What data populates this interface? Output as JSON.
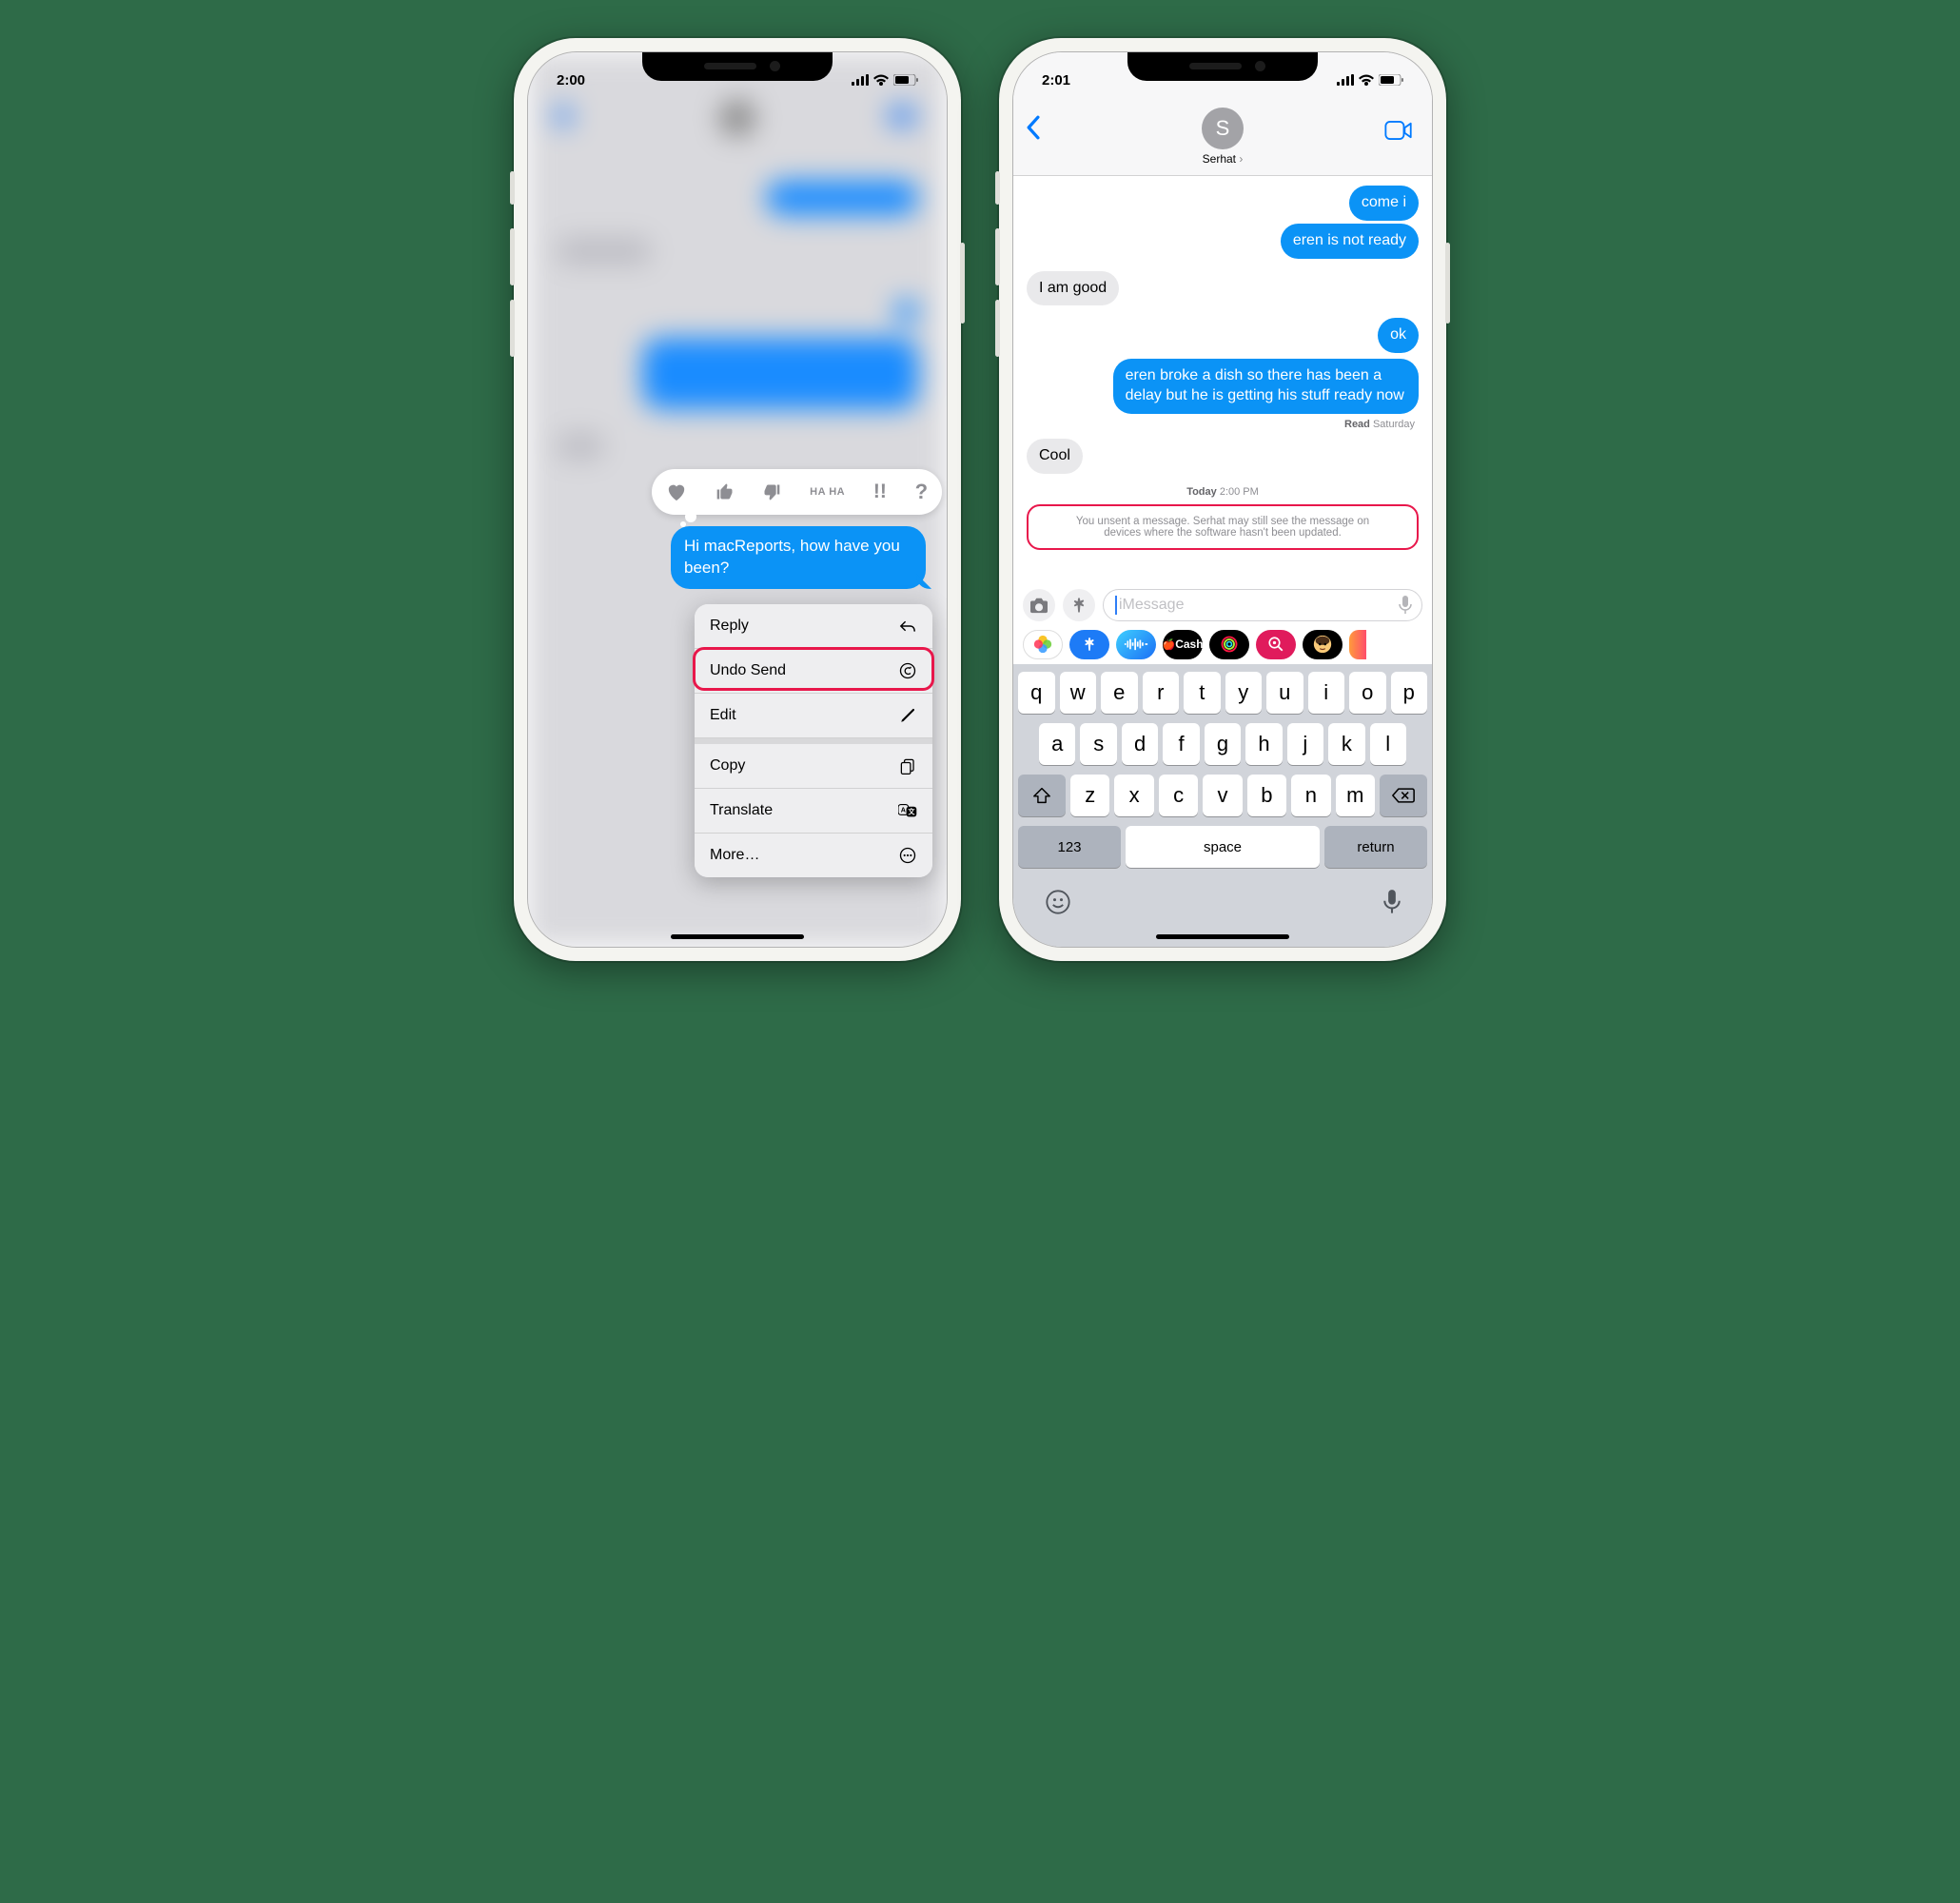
{
  "left": {
    "status_time": "2:00",
    "selected_message": "Hi macReports, how have you been?",
    "reactions": [
      "heart",
      "thumbs-up",
      "thumbs-down",
      "haha",
      "exclaim",
      "question"
    ],
    "haha_text": "HA HA",
    "exclaim_text": "!!",
    "question_text": "?",
    "menu": {
      "reply": "Reply",
      "undo_send": "Undo Send",
      "edit": "Edit",
      "copy": "Copy",
      "translate": "Translate",
      "more": "More…"
    }
  },
  "right": {
    "status_time": "2:01",
    "contact_initial": "S",
    "contact_name": "Serhat",
    "messages": {
      "m1": "come i",
      "m2": "eren is not ready",
      "m3": "I am good",
      "m4": "ok",
      "m5": "eren broke a dish so there has been a delay but he is getting his stuff ready now",
      "m6": "Cool"
    },
    "read_label": "Read",
    "read_day": "Saturday",
    "timestamp_day": "Today",
    "timestamp_time": "2:00 PM",
    "unsent_notice": "You unsent a message. Serhat may still see the message on devices where the software hasn't been updated.",
    "input_placeholder": "iMessage",
    "app_cash_label": "Cash",
    "keyboard": {
      "row1": [
        "q",
        "w",
        "e",
        "r",
        "t",
        "y",
        "u",
        "i",
        "o",
        "p"
      ],
      "row2": [
        "a",
        "s",
        "d",
        "f",
        "g",
        "h",
        "j",
        "k",
        "l"
      ],
      "row3": [
        "z",
        "x",
        "c",
        "v",
        "b",
        "n",
        "m"
      ],
      "num": "123",
      "space": "space",
      "return": "return"
    }
  }
}
